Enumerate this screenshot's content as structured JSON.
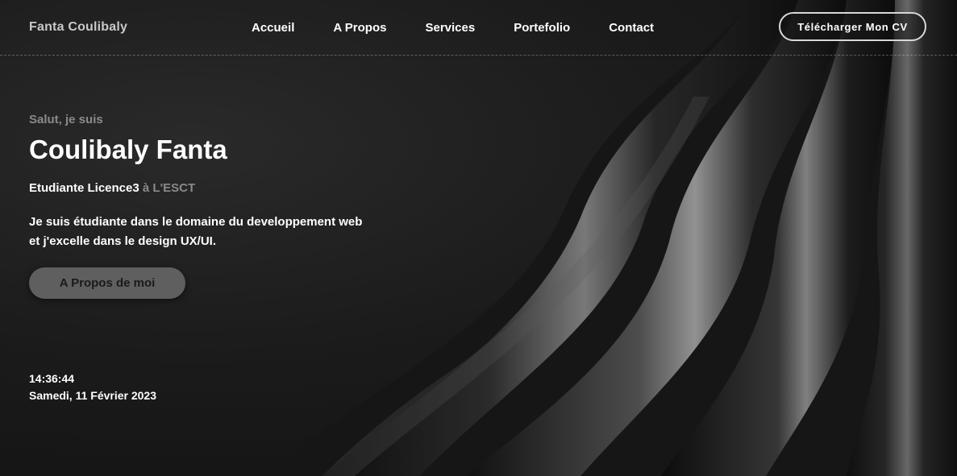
{
  "header": {
    "logo": "Fanta Coulibaly",
    "nav": [
      "Accueil",
      "A Propos",
      "Services",
      "Portefolio",
      "Contact"
    ],
    "cv_button": "Télécharger Mon CV"
  },
  "hero": {
    "greeting": "Salut, je suis",
    "name": "Coulibaly Fanta",
    "subtitle_strong": "Etudiante Licence3",
    "subtitle_muted": "à L'ESCT",
    "description_line1": "Je suis étudiante dans le domaine du developpement web",
    "description_line2": "et j'excelle dans le design UX/UI.",
    "about_button": "A Propos de moi"
  },
  "clock": {
    "time": "14:36:44",
    "date": "Samedi, 11 Février 2023"
  },
  "colors": {
    "background": "#141414",
    "muted_text": "#8a8a8a",
    "button_fill": "#5f5f5f"
  }
}
